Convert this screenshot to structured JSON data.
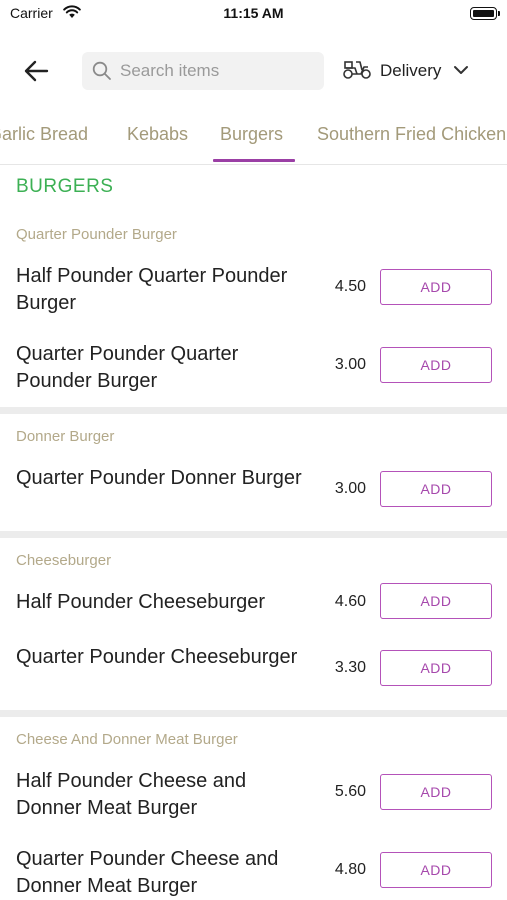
{
  "status_bar": {
    "carrier": "Carrier",
    "time": "11:15 AM"
  },
  "header": {
    "search_placeholder": "Search items",
    "delivery_label": "Delivery"
  },
  "tabs": [
    {
      "label": "Garlic Bread"
    },
    {
      "label": "Kebabs"
    },
    {
      "label": "Burgers",
      "active": true
    },
    {
      "label": "Southern Fried Chicken"
    }
  ],
  "section": {
    "heading": "BURGERS"
  },
  "categories": [
    {
      "title": "Quarter Pounder Burger",
      "items": [
        {
          "name": "Half Pounder Quarter Pounder Burger",
          "price": "4.50",
          "button": "ADD"
        },
        {
          "name": "Quarter Pounder Quarter Pounder Burger",
          "price": "3.00",
          "button": "ADD"
        }
      ]
    },
    {
      "title": "Donner Burger",
      "items": [
        {
          "name": "Quarter Pounder Donner Burger",
          "price": "3.00",
          "button": "ADD"
        }
      ]
    },
    {
      "title": "Cheeseburger",
      "items": [
        {
          "name": "Half Pounder Cheeseburger",
          "price": "4.60",
          "button": "ADD"
        },
        {
          "name": "Quarter Pounder Cheeseburger",
          "price": "3.30",
          "button": "ADD"
        }
      ]
    },
    {
      "title": "Cheese And Donner Meat Burger",
      "items": [
        {
          "name": "Half Pounder Cheese and Donner Meat Burger",
          "price": "5.60",
          "button": "ADD"
        },
        {
          "name": "Quarter Pounder Cheese and Donner Meat Burger",
          "price": "4.80",
          "button": "ADD"
        }
      ]
    }
  ],
  "colors": {
    "accent": "#9b3fa5",
    "section_heading": "#3cb054",
    "category_title": "#b3a98a",
    "tab_text": "#a39a7a"
  }
}
